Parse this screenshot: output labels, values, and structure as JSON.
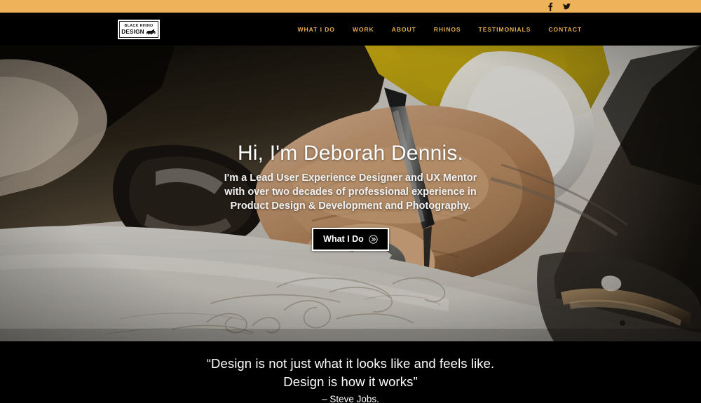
{
  "topbar": {
    "background_color": "#edb25a",
    "social": [
      {
        "name": "facebook-icon",
        "label": "Facebook"
      },
      {
        "name": "twitter-icon",
        "label": "Twitter"
      }
    ]
  },
  "header": {
    "background_color": "#000000",
    "logo": {
      "top_text": "BLACK RHINO",
      "bottom_text": "DESIGN",
      "icon": "rhino-icon"
    },
    "nav": {
      "link_color": "#e3ab4c",
      "items": [
        {
          "label": "WHAT I DO"
        },
        {
          "label": "WORK"
        },
        {
          "label": "ABOUT"
        },
        {
          "label": "RHINOS"
        },
        {
          "label": "TESTIMONIALS"
        },
        {
          "label": "CONTACT"
        }
      ]
    }
  },
  "hero": {
    "title": "Hi, I'm Deborah Dennis.",
    "subtitle_lines": [
      "I'm a Lead User Experience Designer and UX Mentor",
      "with over two decades of professional experience in",
      "Product Design & Development and Photography."
    ],
    "button": {
      "label": "What I Do",
      "icon": "double-chevron-right-icon"
    },
    "image_description": "Close-up photo of a hand with gray nail polish holding a pen, sketching on white paper"
  },
  "quote": {
    "background_color": "#000000",
    "line1": "“Design is not just what it looks like and feels like.",
    "line2": "Design is how it works”",
    "author": "– Steve Jobs."
  }
}
